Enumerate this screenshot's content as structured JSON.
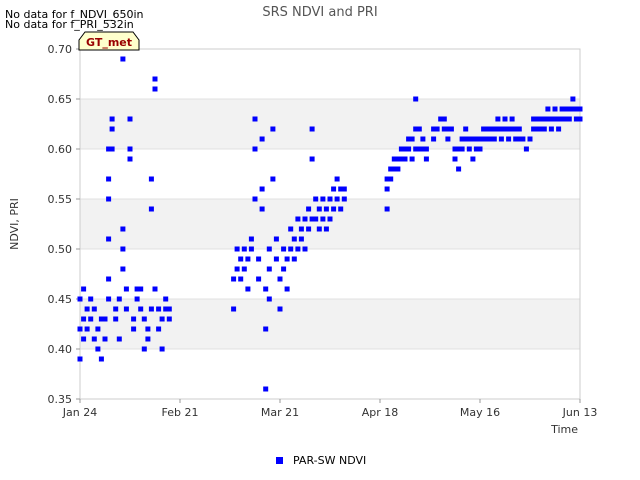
{
  "notes": [
    "No data for f_NDVI_650in",
    "No data for f_PRI_532in"
  ],
  "badge": "GT_met",
  "chart_data": {
    "type": "scatter",
    "title": "SRS NDVI and PRI",
    "xlabel": "Time",
    "ylabel": "NDVI, PRI",
    "xlim": [
      "2023-01-24",
      "2023-06-13"
    ],
    "ylim": [
      0.35,
      0.7
    ],
    "x_ticks": [
      {
        "date": "2023-01-24",
        "label": "Jan 24"
      },
      {
        "date": "2023-02-21",
        "label": "Feb 21"
      },
      {
        "date": "2023-03-21",
        "label": "Mar 21"
      },
      {
        "date": "2023-04-18",
        "label": "Apr 18"
      },
      {
        "date": "2023-05-16",
        "label": "May 16"
      },
      {
        "date": "2023-06-13",
        "label": "Jun 13"
      }
    ],
    "y_ticks": [
      "0.35",
      "0.40",
      "0.45",
      "0.50",
      "0.55",
      "0.60",
      "0.65",
      "0.70"
    ],
    "y_tick_values": [
      0.35,
      0.4,
      0.45,
      0.5,
      0.55,
      0.6,
      0.65,
      0.7
    ],
    "grid": "alternating horizontal bands",
    "legend_position": "bottom-center",
    "series": [
      {
        "name": "PAR-SW NDVI",
        "color": "#0000ff",
        "marker": "square",
        "points": [
          [
            "2023-01-24",
            0.39
          ],
          [
            "2023-01-24",
            0.42
          ],
          [
            "2023-01-24",
            0.45
          ],
          [
            "2023-01-25",
            0.41
          ],
          [
            "2023-01-25",
            0.43
          ],
          [
            "2023-01-25",
            0.46
          ],
          [
            "2023-01-26",
            0.44
          ],
          [
            "2023-01-26",
            0.42
          ],
          [
            "2023-01-27",
            0.45
          ],
          [
            "2023-01-27",
            0.43
          ],
          [
            "2023-01-28",
            0.41
          ],
          [
            "2023-01-28",
            0.44
          ],
          [
            "2023-01-29",
            0.4
          ],
          [
            "2023-01-29",
            0.42
          ],
          [
            "2023-01-30",
            0.43
          ],
          [
            "2023-01-30",
            0.39
          ],
          [
            "2023-01-31",
            0.41
          ],
          [
            "2023-01-31",
            0.43
          ],
          [
            "2023-02-01",
            0.45
          ],
          [
            "2023-02-01",
            0.47
          ],
          [
            "2023-02-01",
            0.51
          ],
          [
            "2023-02-01",
            0.55
          ],
          [
            "2023-02-01",
            0.57
          ],
          [
            "2023-02-01",
            0.6
          ],
          [
            "2023-02-02",
            0.6
          ],
          [
            "2023-02-02",
            0.62
          ],
          [
            "2023-02-02",
            0.63
          ],
          [
            "2023-02-03",
            0.43
          ],
          [
            "2023-02-03",
            0.44
          ],
          [
            "2023-02-04",
            0.45
          ],
          [
            "2023-02-04",
            0.41
          ],
          [
            "2023-02-05",
            0.69
          ],
          [
            "2023-02-05",
            0.52
          ],
          [
            "2023-02-05",
            0.5
          ],
          [
            "2023-02-05",
            0.48
          ],
          [
            "2023-02-06",
            0.44
          ],
          [
            "2023-02-06",
            0.46
          ],
          [
            "2023-02-07",
            0.63
          ],
          [
            "2023-02-07",
            0.6
          ],
          [
            "2023-02-07",
            0.59
          ],
          [
            "2023-02-08",
            0.43
          ],
          [
            "2023-02-08",
            0.42
          ],
          [
            "2023-02-09",
            0.45
          ],
          [
            "2023-02-09",
            0.46
          ],
          [
            "2023-02-10",
            0.44
          ],
          [
            "2023-02-10",
            0.46
          ],
          [
            "2023-02-11",
            0.43
          ],
          [
            "2023-02-11",
            0.4
          ],
          [
            "2023-02-12",
            0.42
          ],
          [
            "2023-02-12",
            0.41
          ],
          [
            "2023-02-13",
            0.44
          ],
          [
            "2023-02-13",
            0.57
          ],
          [
            "2023-02-13",
            0.54
          ],
          [
            "2023-02-14",
            0.66
          ],
          [
            "2023-02-14",
            0.67
          ],
          [
            "2023-02-14",
            0.46
          ],
          [
            "2023-02-15",
            0.44
          ],
          [
            "2023-02-15",
            0.42
          ],
          [
            "2023-02-16",
            0.43
          ],
          [
            "2023-02-16",
            0.4
          ],
          [
            "2023-02-17",
            0.44
          ],
          [
            "2023-02-17",
            0.45
          ],
          [
            "2023-02-18",
            0.43
          ],
          [
            "2023-02-18",
            0.44
          ],
          [
            "2023-03-08",
            0.44
          ],
          [
            "2023-03-08",
            0.47
          ],
          [
            "2023-03-09",
            0.48
          ],
          [
            "2023-03-09",
            0.5
          ],
          [
            "2023-03-10",
            0.49
          ],
          [
            "2023-03-10",
            0.47
          ],
          [
            "2023-03-11",
            0.48
          ],
          [
            "2023-03-11",
            0.5
          ],
          [
            "2023-03-12",
            0.49
          ],
          [
            "2023-03-12",
            0.46
          ],
          [
            "2023-03-13",
            0.5
          ],
          [
            "2023-03-13",
            0.51
          ],
          [
            "2023-03-14",
            0.63
          ],
          [
            "2023-03-14",
            0.6
          ],
          [
            "2023-03-14",
            0.55
          ],
          [
            "2023-03-15",
            0.49
          ],
          [
            "2023-03-15",
            0.47
          ],
          [
            "2023-03-16",
            0.61
          ],
          [
            "2023-03-16",
            0.56
          ],
          [
            "2023-03-16",
            0.54
          ],
          [
            "2023-03-17",
            0.36
          ],
          [
            "2023-03-17",
            0.42
          ],
          [
            "2023-03-17",
            0.46
          ],
          [
            "2023-03-18",
            0.45
          ],
          [
            "2023-03-18",
            0.48
          ],
          [
            "2023-03-18",
            0.5
          ],
          [
            "2023-03-19",
            0.62
          ],
          [
            "2023-03-19",
            0.57
          ],
          [
            "2023-03-20",
            0.51
          ],
          [
            "2023-03-20",
            0.49
          ],
          [
            "2023-03-21",
            0.47
          ],
          [
            "2023-03-21",
            0.44
          ],
          [
            "2023-03-22",
            0.5
          ],
          [
            "2023-03-22",
            0.48
          ],
          [
            "2023-03-23",
            0.49
          ],
          [
            "2023-03-23",
            0.46
          ],
          [
            "2023-03-24",
            0.5
          ],
          [
            "2023-03-24",
            0.52
          ],
          [
            "2023-03-25",
            0.49
          ],
          [
            "2023-03-25",
            0.51
          ],
          [
            "2023-03-26",
            0.53
          ],
          [
            "2023-03-26",
            0.5
          ],
          [
            "2023-03-27",
            0.52
          ],
          [
            "2023-03-27",
            0.51
          ],
          [
            "2023-03-28",
            0.53
          ],
          [
            "2023-03-28",
            0.5
          ],
          [
            "2023-03-29",
            0.52
          ],
          [
            "2023-03-29",
            0.54
          ],
          [
            "2023-03-30",
            0.53
          ],
          [
            "2023-03-30",
            0.62
          ],
          [
            "2023-03-30",
            0.59
          ],
          [
            "2023-03-31",
            0.55
          ],
          [
            "2023-03-31",
            0.53
          ],
          [
            "2023-04-01",
            0.54
          ],
          [
            "2023-04-01",
            0.52
          ],
          [
            "2023-04-02",
            0.53
          ],
          [
            "2023-04-02",
            0.55
          ],
          [
            "2023-04-03",
            0.54
          ],
          [
            "2023-04-03",
            0.52
          ],
          [
            "2023-04-04",
            0.55
          ],
          [
            "2023-04-04",
            0.53
          ],
          [
            "2023-04-05",
            0.54
          ],
          [
            "2023-04-05",
            0.56
          ],
          [
            "2023-04-06",
            0.55
          ],
          [
            "2023-04-06",
            0.57
          ],
          [
            "2023-04-07",
            0.56
          ],
          [
            "2023-04-07",
            0.54
          ],
          [
            "2023-04-08",
            0.56
          ],
          [
            "2023-04-08",
            0.55
          ],
          [
            "2023-04-20",
            0.56
          ],
          [
            "2023-04-20",
            0.54
          ],
          [
            "2023-04-20",
            0.57
          ],
          [
            "2023-04-21",
            0.58
          ],
          [
            "2023-04-21",
            0.57
          ],
          [
            "2023-04-22",
            0.58
          ],
          [
            "2023-04-22",
            0.59
          ],
          [
            "2023-04-23",
            0.58
          ],
          [
            "2023-04-23",
            0.59
          ],
          [
            "2023-04-24",
            0.6
          ],
          [
            "2023-04-24",
            0.59
          ],
          [
            "2023-04-25",
            0.6
          ],
          [
            "2023-04-25",
            0.59
          ],
          [
            "2023-04-26",
            0.6
          ],
          [
            "2023-04-26",
            0.61
          ],
          [
            "2023-04-27",
            0.59
          ],
          [
            "2023-04-27",
            0.61
          ],
          [
            "2023-04-28",
            0.6
          ],
          [
            "2023-04-28",
            0.62
          ],
          [
            "2023-04-28",
            0.65
          ],
          [
            "2023-04-29",
            0.62
          ],
          [
            "2023-04-29",
            0.6
          ],
          [
            "2023-04-30",
            0.61
          ],
          [
            "2023-04-30",
            0.6
          ],
          [
            "2023-05-01",
            0.59
          ],
          [
            "2023-05-01",
            0.6
          ],
          [
            "2023-05-03",
            0.61
          ],
          [
            "2023-05-03",
            0.62
          ],
          [
            "2023-05-04",
            0.62
          ],
          [
            "2023-05-05",
            0.63
          ],
          [
            "2023-05-06",
            0.62
          ],
          [
            "2023-05-06",
            0.63
          ],
          [
            "2023-05-07",
            0.61
          ],
          [
            "2023-05-07",
            0.62
          ],
          [
            "2023-05-08",
            0.62
          ],
          [
            "2023-05-09",
            0.6
          ],
          [
            "2023-05-09",
            0.59
          ],
          [
            "2023-05-10",
            0.58
          ],
          [
            "2023-05-10",
            0.6
          ],
          [
            "2023-05-11",
            0.6
          ],
          [
            "2023-05-11",
            0.61
          ],
          [
            "2023-05-12",
            0.62
          ],
          [
            "2023-05-12",
            0.61
          ],
          [
            "2023-05-13",
            0.6
          ],
          [
            "2023-05-13",
            0.61
          ],
          [
            "2023-05-14",
            0.59
          ],
          [
            "2023-05-14",
            0.61
          ],
          [
            "2023-05-15",
            0.6
          ],
          [
            "2023-05-15",
            0.61
          ],
          [
            "2023-05-16",
            0.61
          ],
          [
            "2023-05-16",
            0.6
          ],
          [
            "2023-05-17",
            0.61
          ],
          [
            "2023-05-17",
            0.62
          ],
          [
            "2023-05-18",
            0.62
          ],
          [
            "2023-05-18",
            0.61
          ],
          [
            "2023-05-19",
            0.61
          ],
          [
            "2023-05-19",
            0.62
          ],
          [
            "2023-05-20",
            0.62
          ],
          [
            "2023-05-20",
            0.61
          ],
          [
            "2023-05-21",
            0.62
          ],
          [
            "2023-05-21",
            0.63
          ],
          [
            "2023-05-22",
            0.62
          ],
          [
            "2023-05-22",
            0.61
          ],
          [
            "2023-05-23",
            0.62
          ],
          [
            "2023-05-23",
            0.63
          ],
          [
            "2023-05-24",
            0.62
          ],
          [
            "2023-05-24",
            0.61
          ],
          [
            "2023-05-25",
            0.62
          ],
          [
            "2023-05-25",
            0.63
          ],
          [
            "2023-05-26",
            0.62
          ],
          [
            "2023-05-26",
            0.61
          ],
          [
            "2023-05-27",
            0.61
          ],
          [
            "2023-05-27",
            0.62
          ],
          [
            "2023-05-28",
            0.61
          ],
          [
            "2023-05-29",
            0.6
          ],
          [
            "2023-05-30",
            0.61
          ],
          [
            "2023-05-31",
            0.62
          ],
          [
            "2023-05-31",
            0.63
          ],
          [
            "2023-06-01",
            0.62
          ],
          [
            "2023-06-01",
            0.63
          ],
          [
            "2023-06-02",
            0.62
          ],
          [
            "2023-06-02",
            0.63
          ],
          [
            "2023-06-03",
            0.63
          ],
          [
            "2023-06-03",
            0.62
          ],
          [
            "2023-06-04",
            0.63
          ],
          [
            "2023-06-04",
            0.64
          ],
          [
            "2023-06-05",
            0.63
          ],
          [
            "2023-06-05",
            0.62
          ],
          [
            "2023-06-06",
            0.63
          ],
          [
            "2023-06-06",
            0.64
          ],
          [
            "2023-06-07",
            0.63
          ],
          [
            "2023-06-07",
            0.62
          ],
          [
            "2023-06-08",
            0.64
          ],
          [
            "2023-06-08",
            0.63
          ],
          [
            "2023-06-09",
            0.63
          ],
          [
            "2023-06-09",
            0.64
          ],
          [
            "2023-06-10",
            0.64
          ],
          [
            "2023-06-10",
            0.63
          ],
          [
            "2023-06-11",
            0.65
          ],
          [
            "2023-06-11",
            0.64
          ],
          [
            "2023-06-12",
            0.64
          ],
          [
            "2023-06-12",
            0.63
          ],
          [
            "2023-06-13",
            0.64
          ],
          [
            "2023-06-13",
            0.63
          ]
        ]
      }
    ]
  }
}
